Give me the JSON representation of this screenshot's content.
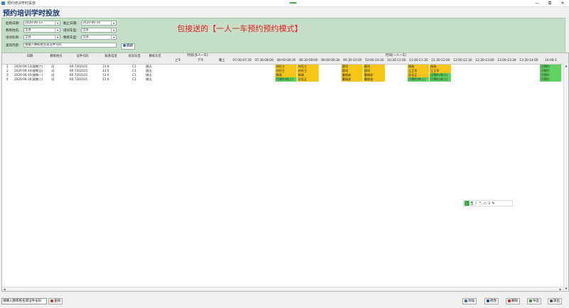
{
  "window": {
    "title": "预约培训学时投放",
    "min_label": "—",
    "max_label": "⧉",
    "close_label": "✕"
  },
  "page_title": "预约培训学时投放",
  "annotation": "包接送的【一人一车预约预约模式】",
  "filters": {
    "start_date_label": "起始日期:",
    "start_date": "2020-06-13",
    "end_date_label": "截止日期:",
    "end_date": "2020-06-16",
    "coach_label": "教练姓名:",
    "coach_value": "全部",
    "vehicle_type_label": "培训车型:",
    "vehicle_type_value": "全部",
    "subject_label": "培训科目:",
    "subject_value": "全部",
    "coach_vehicle_label": "教练车型:",
    "coach_vehicle_value": "全部",
    "query_label": "查询内容:",
    "query_placeholder": "请输入教练姓名或证件号码",
    "refresh_label": "刷新"
  },
  "table": {
    "columns": [
      "日期",
      "教练姓名",
      "证件号码",
      "联系电话",
      "培训车型",
      "教练车型"
    ],
    "group_shuttle": "时段(多人一车)",
    "shuttle_cols": [
      "上午",
      "下午",
      "晚上"
    ],
    "group_time": "时间(一人一车)",
    "time_slots": [
      "07:00-07:30",
      "07:30-08:00",
      "08:00-08:30",
      "08:30-09:00",
      "09:00-09:30",
      "09:30-10:00",
      "10:00-10:30",
      "10:30-11:00",
      "11:00-11:30",
      "11:30-12:00",
      "12:00-12:30",
      "12:30-13:00",
      "13:00-13:30",
      "13:30-14:00",
      "14:00-1"
    ],
    "rows": [
      {
        "no": "1",
        "date": "2020-06-13(星期六)",
        "coach": "试",
        "id": "60  7202101",
        "phone": "13  6",
        "vtype": "C1",
        "ctype": "捷达",
        "slots": {
          "2": "刘旺三",
          "3": "刘旺三",
          "5": "薛冈",
          "6": "薛冈",
          "8": "杨政",
          "9": "杨政",
          "14": "可预约"
        }
      },
      {
        "no": "2",
        "date": "2020-06-14(星期日)",
        "coach": "试",
        "id": "60  7202101",
        "phone": "13  6",
        "vtype": "C1",
        "ctype": "捷达",
        "slots": {
          "2": "刘旺三",
          "3": "刘旺三",
          "5": "薛冈",
          "6": "薛冈",
          "8": "王王军",
          "9": "王王军",
          "14": "可预约"
        }
      },
      {
        "no": "3",
        "date": "2020-06-15(星期一)",
        "coach": "试",
        "id": "60  7202101",
        "phone": "13  6",
        "vtype": "C1",
        "ctype": "捷达",
        "slots": {
          "2": "杨政",
          "3": "杨政",
          "5": "曹顺安",
          "6": "曹顺安",
          "8": "吴佳正",
          "9": "可预约(科二)",
          "14": "可预约"
        }
      },
      {
        "no": "4",
        "date": "2020-06-16(星期二)",
        "coach": "试",
        "id": "60  7202101",
        "phone": "13  6",
        "vtype": "C1",
        "ctype": "捷达",
        "slots": {
          "2": "可预约(科二)",
          "3": "吴佳正",
          "5": "曹顺安",
          "6": "曹顺安",
          "8": "可预约(科二)",
          "9": "可预约(科二)",
          "14": "可预约"
        }
      }
    ]
  },
  "ime": {
    "label": "五",
    "icons": "☾ °, ▭ ⇩ ✎"
  },
  "bottom": {
    "search_placeholder": "请输入教练姓名或证件号码",
    "find_label": "查找",
    "add_label": "添加",
    "edit_label": "修改",
    "delete_label": "删除",
    "export_label": "导出",
    "exit_label": "退出"
  },
  "colors": {
    "booked": "#f5c518",
    "available": "#5ed35e",
    "panel": "#c6dfc8",
    "title": "#1a3c78",
    "annotation": "#e02020"
  }
}
